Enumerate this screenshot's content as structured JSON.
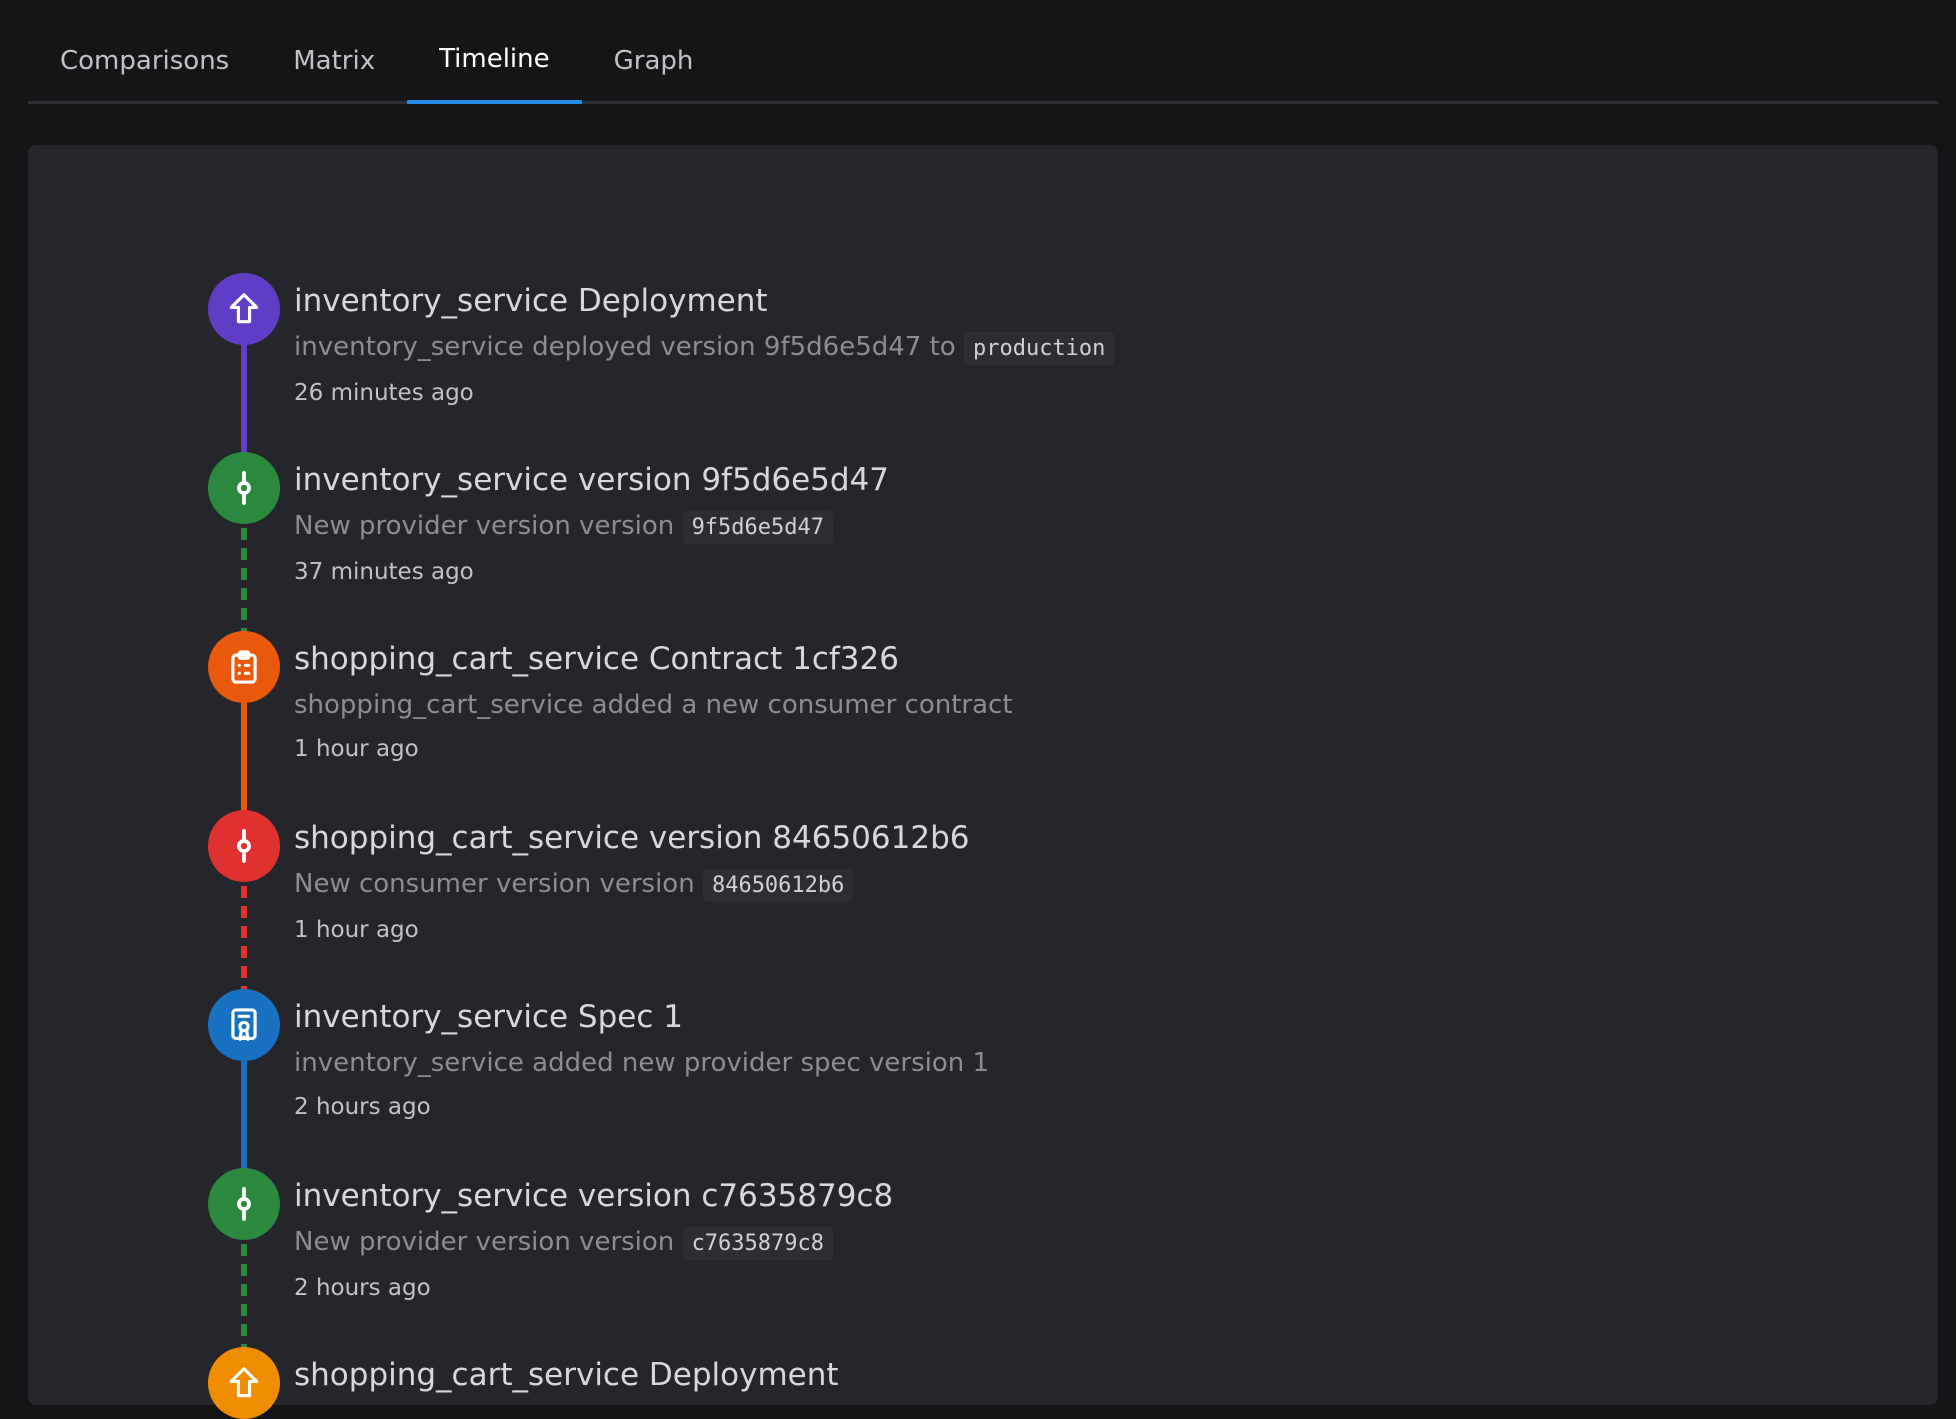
{
  "tabs": [
    "Comparisons",
    "Matrix",
    "Timeline",
    "Graph"
  ],
  "active_tab": "Timeline",
  "colors": {
    "deployment": "#5f3dc4",
    "provider_version": "#2b8a3e",
    "contract": "#e8590c",
    "consumer_version": "#e03131",
    "spec": "#1971c2",
    "deployment_alt": "#f08c00"
  },
  "timeline": [
    {
      "kind": "deployment",
      "icon": "arrow-up-icon",
      "title": "inventory_service Deployment",
      "desc_prefix": "inventory_service deployed version 9f5d6e5d47 to",
      "desc_code": "production",
      "time": "26 minutes ago"
    },
    {
      "kind": "provider_version",
      "icon": "git-commit-icon",
      "title": "inventory_service version 9f5d6e5d47",
      "desc_prefix": "New provider version version",
      "desc_code": "9f5d6e5d47",
      "time": "37 minutes ago"
    },
    {
      "kind": "contract",
      "icon": "clipboard-list-icon",
      "title": "shopping_cart_service Contract 1cf326",
      "desc_prefix": "shopping_cart_service added a new consumer contract",
      "desc_code": "",
      "time": "1 hour ago"
    },
    {
      "kind": "consumer_version",
      "icon": "git-commit-icon",
      "title": "shopping_cart_service version 84650612b6",
      "desc_prefix": "New consumer version version",
      "desc_code": "84650612b6",
      "time": "1 hour ago"
    },
    {
      "kind": "spec",
      "icon": "certificate-icon",
      "title": "inventory_service Spec 1",
      "desc_prefix": "inventory_service added new provider spec version 1",
      "desc_code": "",
      "time": "2 hours ago"
    },
    {
      "kind": "provider_version",
      "icon": "git-commit-icon",
      "title": "inventory_service version c7635879c8",
      "desc_prefix": "New provider version version",
      "desc_code": "c7635879c8",
      "time": "2 hours ago"
    },
    {
      "kind": "deployment_alt",
      "icon": "arrow-up-icon",
      "title": "shopping_cart_service Deployment",
      "desc_prefix": "",
      "desc_code": "",
      "time": ""
    }
  ]
}
